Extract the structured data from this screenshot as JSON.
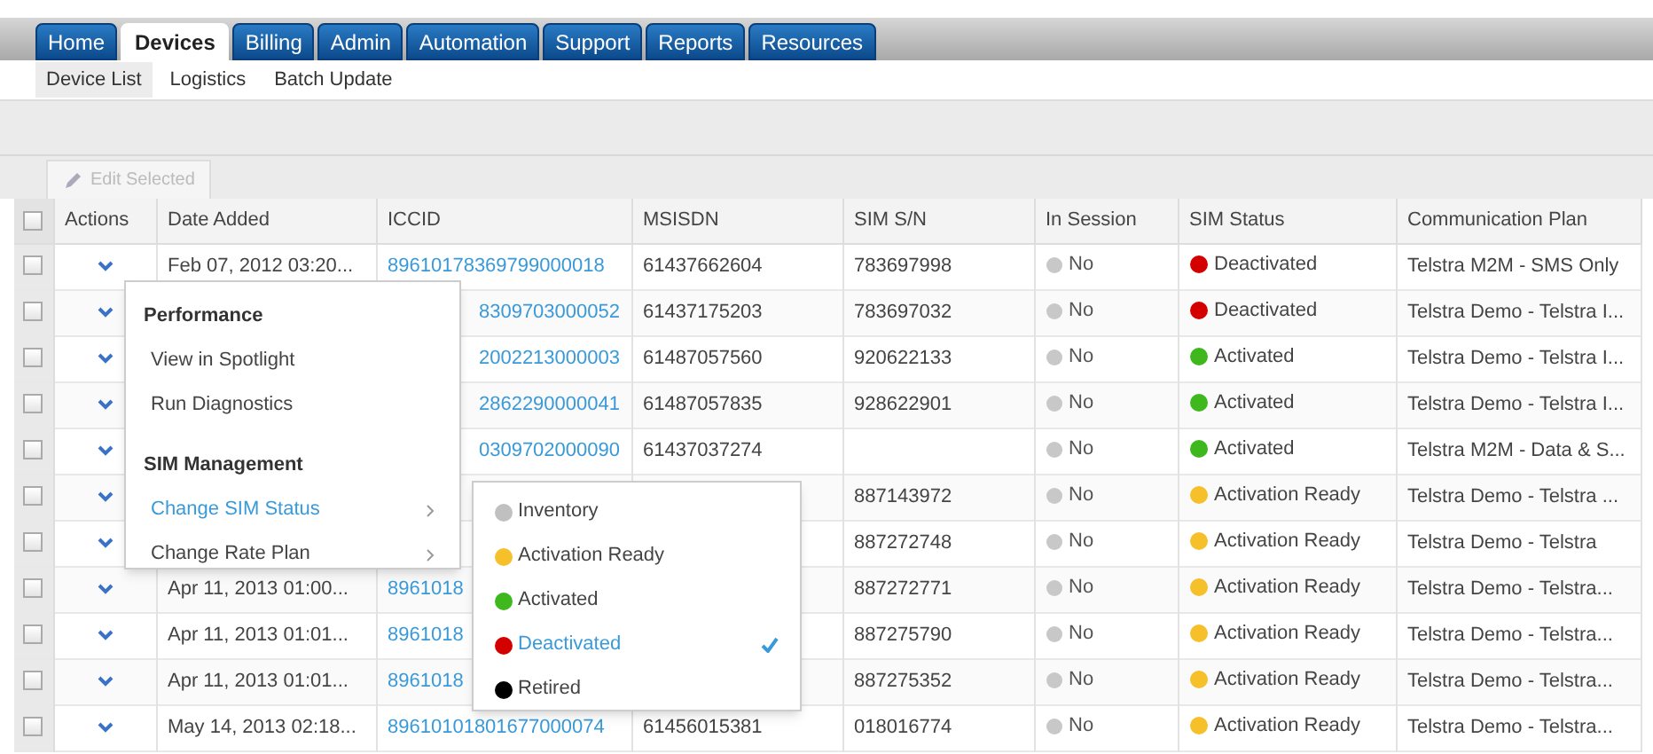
{
  "tabs": [
    {
      "label": "Home",
      "selected": false
    },
    {
      "label": "Devices",
      "selected": true
    },
    {
      "label": "Billing",
      "selected": false
    },
    {
      "label": "Admin",
      "selected": false
    },
    {
      "label": "Automation",
      "selected": false
    },
    {
      "label": "Support",
      "selected": false
    },
    {
      "label": "Reports",
      "selected": false
    },
    {
      "label": "Resources",
      "selected": false
    }
  ],
  "subnav": [
    {
      "label": "Device List",
      "selected": true
    },
    {
      "label": "Logistics",
      "selected": false
    },
    {
      "label": "Batch Update",
      "selected": false
    }
  ],
  "toolbar": {
    "edit_button": {
      "label": "Edit Selected",
      "disabled": true
    }
  },
  "table": {
    "select_all": {
      "checked": false
    },
    "columns": [
      "Actions",
      "Date Added",
      "ICCID",
      "MSISDN",
      "SIM S/N",
      "In Session",
      "SIM Status",
      "Communication Plan"
    ],
    "rows": [
      {
        "checked": false,
        "date_added": "Feb 07, 2012 03:20...",
        "iccid": "89610178369799000018",
        "msisdn": "61437662604",
        "sim_sn": "783697998",
        "in_session": "No",
        "sim_status": "Deactivated",
        "color": "#d40000",
        "plan": "Telstra M2M - SMS Only"
      },
      {
        "checked": false,
        "iccid": "8309703000052",
        "msisdn": "61437175203",
        "sim_sn": "783697032",
        "in_session": "No",
        "sim_status": "Deactivated",
        "color": "#d40000",
        "plan": "Telstra Demo - Telstra I..."
      },
      {
        "checked": false,
        "iccid": "2002213000003",
        "msisdn": "61487057560",
        "sim_sn": "920622133",
        "in_session": "No",
        "sim_status": "Activated",
        "color": "#3fb81e",
        "plan": "Telstra Demo - Telstra I..."
      },
      {
        "checked": false,
        "iccid": "2862290000041",
        "msisdn": "61487057835",
        "sim_sn": "928622901",
        "in_session": "No",
        "sim_status": "Activated",
        "color": "#3fb81e",
        "plan": "Telstra Demo - Telstra I..."
      },
      {
        "checked": false,
        "iccid": "0309702000090",
        "msisdn": "61437037274",
        "in_session": "No",
        "sim_status": "Activated",
        "color": "#3fb81e",
        "plan": "Telstra M2M - Data & S..."
      },
      {
        "checked": false,
        "sim_sn": "887143972",
        "in_session": "No",
        "sim_status": "Activation Ready",
        "color": "#f5c02a",
        "plan": "Telstra Demo - Telstra ..."
      },
      {
        "checked": false,
        "sim_sn": "887272748",
        "in_session": "No",
        "sim_status": "Activation Ready",
        "color": "#f5c02a",
        "plan": "Telstra Demo - Telstra"
      },
      {
        "checked": false,
        "date_added": "Apr 11, 2013 01:00...",
        "iccid": "8961018",
        "sim_sn": "887272771",
        "in_session": "No",
        "sim_status": "Activation Ready",
        "color": "#f5c02a",
        "plan": "Telstra Demo - Telstra..."
      },
      {
        "checked": false,
        "date_added": "Apr 11, 2013 01:01...",
        "iccid": "8961018",
        "sim_sn": "887275790",
        "in_session": "No",
        "sim_status": "Activation Ready",
        "color": "#f5c02a",
        "plan": "Telstra Demo - Telstra..."
      },
      {
        "checked": false,
        "date_added": "Apr 11, 2013 01:01...",
        "iccid": "8961018",
        "sim_sn": "887275352",
        "in_session": "No",
        "sim_status": "Activation Ready",
        "color": "#f5c02a",
        "plan": "Telstra Demo - Telstra..."
      },
      {
        "checked": false,
        "date_added": "May 14, 2013 02:18...",
        "iccid": "89610101801677000074",
        "msisdn": "61456015381",
        "sim_sn": "018016774",
        "in_session": "No",
        "sim_status": "Activation Ready",
        "color": "#f5c02a",
        "plan": "Telstra Demo - Telstra..."
      }
    ]
  },
  "actions_menu": {
    "items": [
      {
        "kind": "header",
        "label": "Performance"
      },
      {
        "kind": "item",
        "label": "View in Spotlight",
        "selected": false,
        "submenu": false
      },
      {
        "kind": "item",
        "label": "Run Diagnostics",
        "selected": false,
        "submenu": false
      },
      {
        "kind": "header",
        "label": "SIM Management"
      },
      {
        "kind": "item",
        "label": "Change SIM Status",
        "selected": true,
        "submenu": true
      },
      {
        "kind": "item",
        "label": "Change Rate Plan",
        "selected": false,
        "submenu": true
      }
    ]
  },
  "status_submenu": {
    "items": [
      {
        "label": "Inventory",
        "color": "#c0c0c0",
        "selected": false
      },
      {
        "label": "Activation Ready",
        "color": "#f5c02a",
        "selected": false
      },
      {
        "label": "Activated",
        "color": "#3fb81e",
        "selected": false
      },
      {
        "label": "Deactivated",
        "color": "#d40000",
        "selected": true
      },
      {
        "label": "Retired",
        "color": "#000000",
        "selected": false
      }
    ]
  }
}
